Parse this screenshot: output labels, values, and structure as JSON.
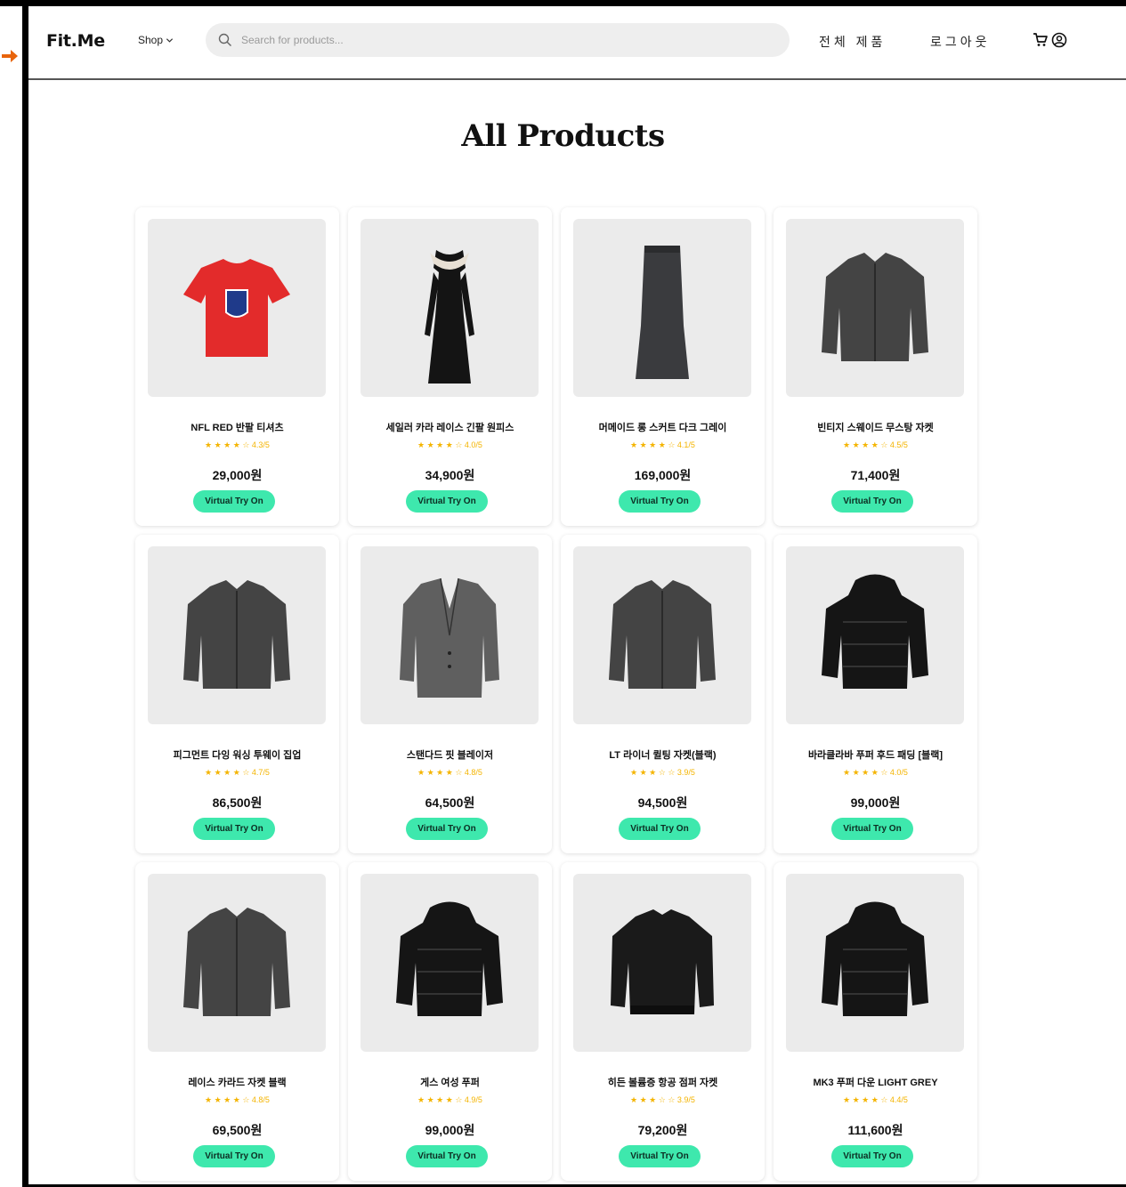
{
  "header": {
    "logo": "Fit.Me",
    "shop_label": "Shop",
    "search_placeholder": "Search for products...",
    "nav_all_products": "전체 제품",
    "nav_logout": "로그아웃",
    "icons": [
      "search-icon",
      "chevron-down-icon",
      "cart-icon",
      "user-icon"
    ]
  },
  "page_title": "All Products",
  "colors": {
    "accent_button": "#3ee8ad",
    "star": "#f4b400",
    "image_bg": "#ebebeb",
    "frame": "#000000",
    "indicator_arrow": "#e8640c"
  },
  "products": [
    {
      "name": "NFL RED 반팔 티셔츠",
      "stars": "★ ★ ★ ★ ☆",
      "rating": "4.3/5",
      "price": "29,000원",
      "button": "Virtual Try On",
      "icon": "tshirt-icon"
    },
    {
      "name": "세일러 카라 레이스 긴팔 원피스",
      "stars": "★ ★ ★ ★ ☆",
      "rating": "4.0/5",
      "price": "34,900원",
      "button": "Virtual Try On",
      "icon": "dress-icon"
    },
    {
      "name": "머메이드 롱 스커트 다크 그레이",
      "stars": "★ ★ ★ ★ ☆",
      "rating": "4.1/5",
      "price": "169,000원",
      "button": "Virtual Try On",
      "icon": "skirt-icon"
    },
    {
      "name": "빈티지 스웨이드 무스탕 자켓",
      "stars": "★ ★ ★ ★ ☆",
      "rating": "4.5/5",
      "price": "71,400원",
      "button": "Virtual Try On",
      "icon": "jacket-icon"
    },
    {
      "name": "피그먼트 다잉 워싱 투웨이 집업",
      "stars": "★ ★ ★ ★ ☆",
      "rating": "4.7/5",
      "price": "86,500원",
      "button": "Virtual Try On",
      "icon": "jacket-icon"
    },
    {
      "name": "스탠다드 핏 블레이저",
      "stars": "★ ★ ★ ★ ☆",
      "rating": "4.8/5",
      "price": "64,500원",
      "button": "Virtual Try On",
      "icon": "blazer-icon"
    },
    {
      "name": "LT 라이너 퀼팅 자켓(블랙)",
      "stars": "★ ★ ★ ☆ ☆",
      "rating": "3.9/5",
      "price": "94,500원",
      "button": "Virtual Try On",
      "icon": "jacket-icon"
    },
    {
      "name": "바라클라바 푸퍼 후드 패딩 [블랙]",
      "stars": "★ ★ ★ ★ ☆",
      "rating": "4.0/5",
      "price": "99,000원",
      "button": "Virtual Try On",
      "icon": "puffer-icon"
    },
    {
      "name": "레이스 카라드 자켓 블랙",
      "stars": "★ ★ ★ ★ ☆",
      "rating": "4.8/5",
      "price": "69,500원",
      "button": "Virtual Try On",
      "icon": "jacket-icon"
    },
    {
      "name": "게스 여성 푸퍼",
      "stars": "★ ★ ★ ★ ☆",
      "rating": "4.9/5",
      "price": "99,000원",
      "button": "Virtual Try On",
      "icon": "puffer-icon"
    },
    {
      "name": "히든 볼륨증 항공 점퍼 자켓",
      "stars": "★ ★ ★ ☆ ☆",
      "rating": "3.9/5",
      "price": "79,200원",
      "button": "Virtual Try On",
      "icon": "bomber-icon"
    },
    {
      "name": "MK3 푸퍼 다운 LIGHT GREY",
      "stars": "★ ★ ★ ★ ☆",
      "rating": "4.4/5",
      "price": "111,600원",
      "button": "Virtual Try On",
      "icon": "puffer-icon"
    }
  ]
}
